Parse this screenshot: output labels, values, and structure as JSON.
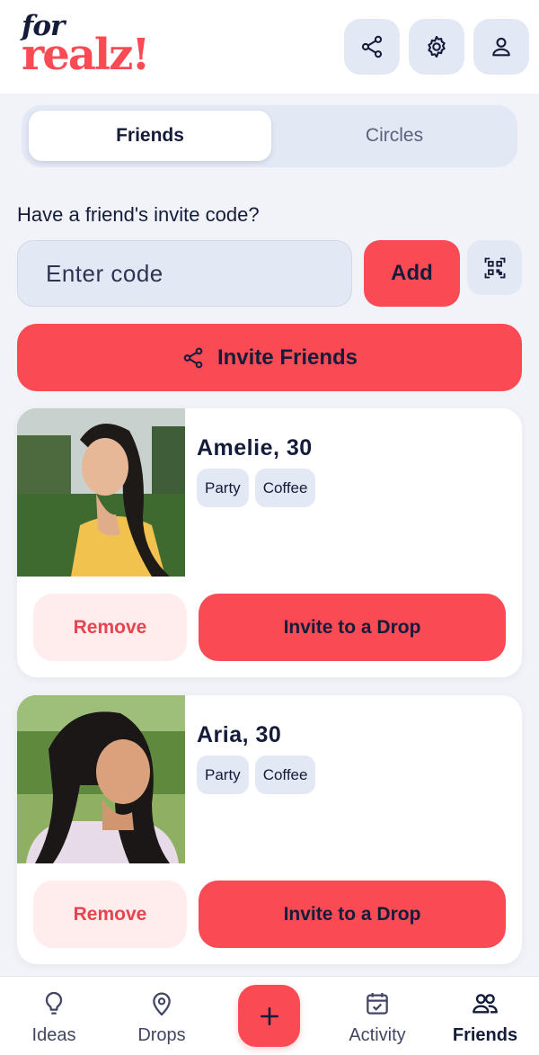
{
  "app": {
    "logo_top": "for",
    "logo_bottom": "realz!"
  },
  "header": {
    "icons": [
      "share-icon",
      "gear-icon",
      "user-icon"
    ]
  },
  "segment": {
    "tabs": [
      {
        "label": "Friends",
        "active": true
      },
      {
        "label": "Circles",
        "active": false
      }
    ]
  },
  "invite": {
    "question": "Have a friend's invite code?",
    "placeholder": "Enter code",
    "value": "",
    "add_label": "Add",
    "invite_friends_label": "Invite Friends"
  },
  "friends": [
    {
      "name": "Amelie, 30",
      "tags": [
        "Party",
        "Coffee"
      ],
      "remove_label": "Remove",
      "invite_label": "Invite to a Drop"
    },
    {
      "name": "Aria, 30",
      "tags": [
        "Party",
        "Coffee"
      ],
      "remove_label": "Remove",
      "invite_label": "Invite to a Drop"
    }
  ],
  "nav": {
    "items": [
      {
        "label": "Ideas",
        "icon": "lightbulb-icon",
        "active": false
      },
      {
        "label": "Drops",
        "icon": "map-pin-icon",
        "active": false
      },
      {
        "label": "Activity",
        "icon": "calendar-check-icon",
        "active": false
      },
      {
        "label": "Friends",
        "icon": "users-icon",
        "active": true
      }
    ],
    "fab_icon": "plus-icon"
  },
  "colors": {
    "accent": "#fa4b55",
    "dark": "#141c3a",
    "soft": "#e3e8f5",
    "background": "#f2f3f9"
  }
}
